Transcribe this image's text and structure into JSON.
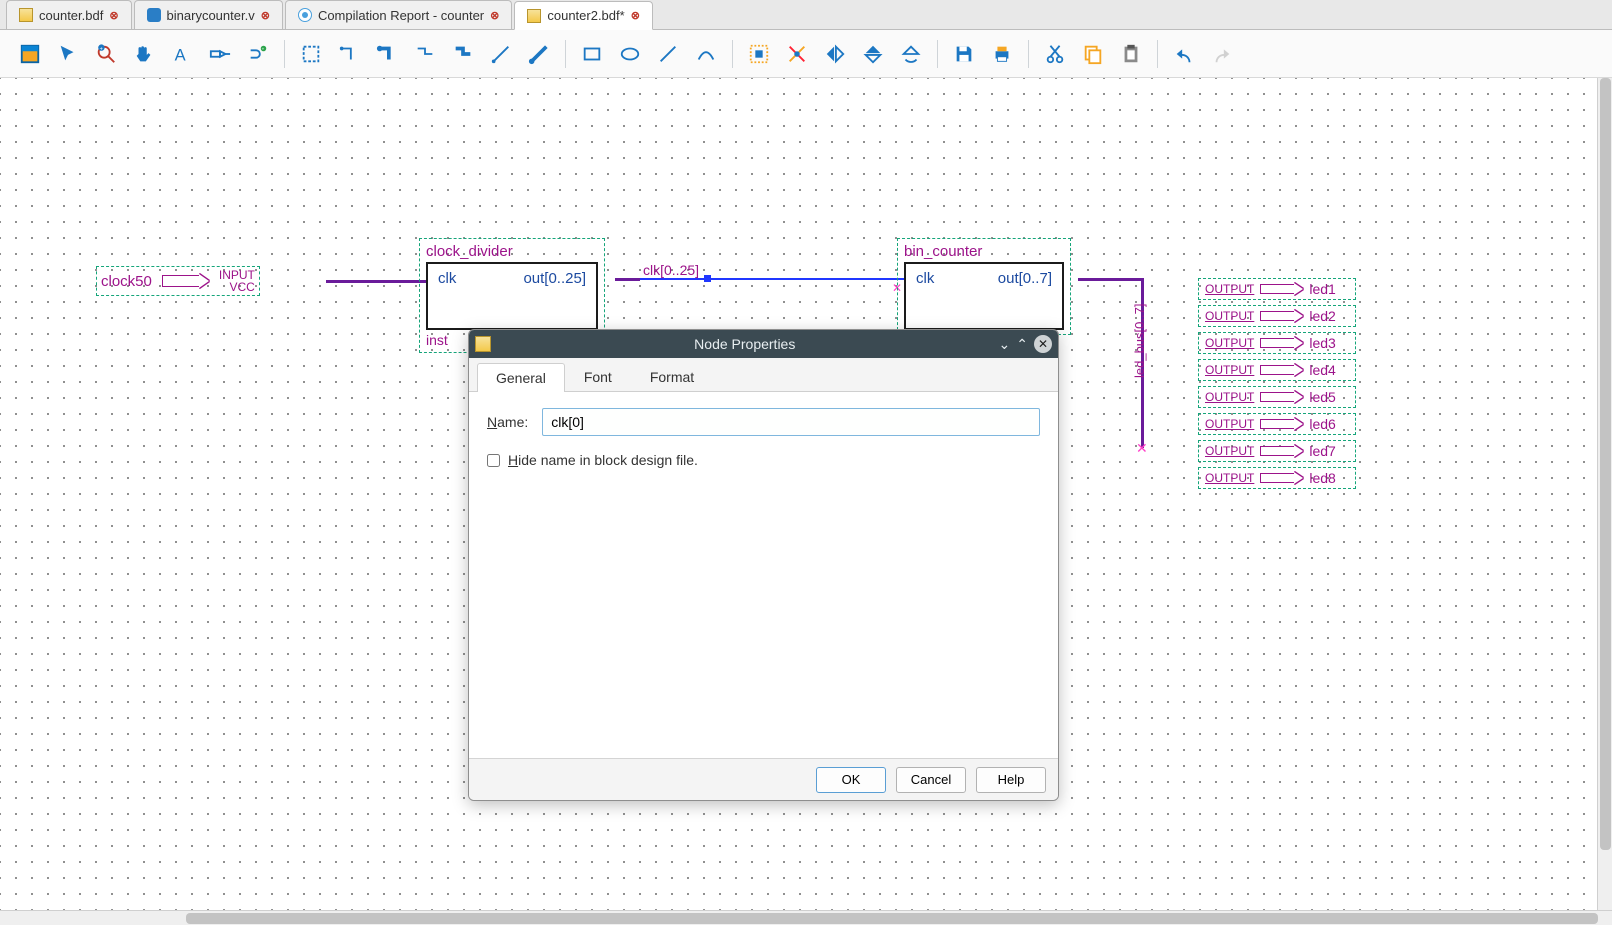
{
  "tabs": [
    {
      "label": "counter.bdf",
      "kind": "bdf",
      "modified": false
    },
    {
      "label": "binarycounter.v",
      "kind": "v",
      "modified": false
    },
    {
      "label": "Compilation Report - counter",
      "kind": "rep",
      "modified": false
    },
    {
      "label": "counter2.bdf*",
      "kind": "bdf",
      "modified": true,
      "active": true
    }
  ],
  "toolbar_icons": [
    "app-icon",
    "pointer-icon",
    "zoom-icon",
    "hand-icon",
    "text-icon",
    "pin-icon",
    "symbol-icon",
    "sep",
    "rect-icon",
    "ortho-line-icon",
    "ortho-bus-icon",
    "elbow-line-icon",
    "elbow-bus-icon",
    "diag-line-icon",
    "diag-bus-icon",
    "sep",
    "rect-shape-icon",
    "oval-icon",
    "line-icon",
    "arc-icon",
    "sep",
    "rubber-icon",
    "partial-sel-icon",
    "flip-h-icon",
    "flip-v-icon",
    "rotate-icon",
    "sep",
    "save-icon",
    "print-icon",
    "sep",
    "cut-icon",
    "copy-icon",
    "paste-icon",
    "sep",
    "undo-icon",
    "redo-icon"
  ],
  "schematic": {
    "input_pin": {
      "name": "clock50",
      "type": "INPUT",
      "tie": "VCC"
    },
    "block1": {
      "title": "clock_divider",
      "in_port": "clk",
      "out_port": "out[0..25]",
      "inst": "inst"
    },
    "block2": {
      "title": "bin_counter",
      "in_port": "clk",
      "out_port": "out[0..7]"
    },
    "wire_label": "clk[0..25]",
    "bus_label": "led_bus[0..7]",
    "outputs": [
      {
        "type": "OUTPUT",
        "name": "led1"
      },
      {
        "type": "OUTPUT",
        "name": "led2"
      },
      {
        "type": "OUTPUT",
        "name": "led3"
      },
      {
        "type": "OUTPUT",
        "name": "led4"
      },
      {
        "type": "OUTPUT",
        "name": "led5"
      },
      {
        "type": "OUTPUT",
        "name": "led6"
      },
      {
        "type": "OUTPUT",
        "name": "led7"
      },
      {
        "type": "OUTPUT",
        "name": "led8"
      }
    ]
  },
  "dialog": {
    "title": "Node Properties",
    "tabs": {
      "general": "General",
      "font": "Font",
      "format": "Format"
    },
    "name_label": "Name:",
    "name_value": "clk[0]",
    "hide_label": "Hide name in block design file.",
    "buttons": {
      "ok": "OK",
      "cancel": "Cancel",
      "help": "Help"
    }
  }
}
